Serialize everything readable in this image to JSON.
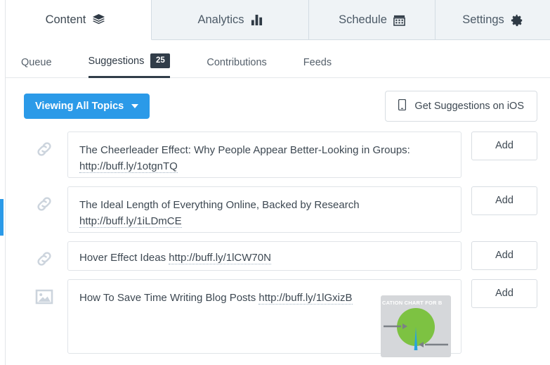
{
  "primary_tabs": [
    {
      "label": "Content",
      "icon": "layers-icon",
      "active": true
    },
    {
      "label": "Analytics",
      "icon": "bar-chart-icon",
      "active": false
    },
    {
      "label": "Schedule",
      "icon": "calendar-icon",
      "active": false
    },
    {
      "label": "Settings",
      "icon": "gear-icon",
      "active": false
    }
  ],
  "secondary_tabs": [
    {
      "label": "Queue",
      "badge": "",
      "active": false
    },
    {
      "label": "Suggestions",
      "badge": "25",
      "active": true
    },
    {
      "label": "Contributions",
      "badge": "",
      "active": false
    },
    {
      "label": "Feeds",
      "badge": "",
      "active": false
    }
  ],
  "action_bar": {
    "topics_button": "Viewing All Topics",
    "ios_button": "Get Suggestions on iOS",
    "ios_icon": "mobile-phone-icon",
    "caret_icon": "chevron-down-icon"
  },
  "suggestions": [
    {
      "icon": "link-icon",
      "title": "The Cheerleader Effect: Why People Appear Better-Looking in Groups:",
      "url": "http://buff.ly/1otgnTQ",
      "layout": "two-line",
      "add_label": "Add"
    },
    {
      "icon": "link-icon",
      "title": "The Ideal Length of Everything Online, Backed by Research",
      "url": "http://buff.ly/1iLDmCE",
      "layout": "two-line",
      "add_label": "Add"
    },
    {
      "icon": "link-icon",
      "title": "Hover Effect Ideas ",
      "url": "http://buff.ly/1lCW70N",
      "layout": "one-line",
      "add_label": "Add"
    },
    {
      "icon": "image-icon",
      "title": "How To Save Time Writing Blog Posts ",
      "url": "http://buff.ly/1lGxizB",
      "layout": "media",
      "add_label": "Add",
      "thumbnail": {
        "caption": "CATION CHART FOR B",
        "type": "pie-chart-image"
      }
    }
  ],
  "scrollbar": {
    "name": "vertical-scrollbar"
  },
  "colors": {
    "accent_blue": "#2b9ae8",
    "dark_navy": "#313d49",
    "tabbar_bg": "#eff3f6",
    "border": "#e0e4e8"
  }
}
